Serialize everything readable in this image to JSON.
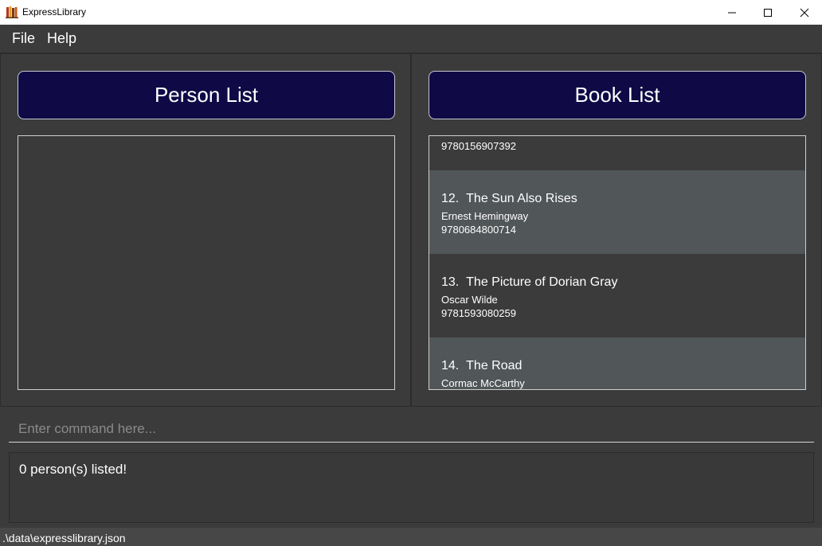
{
  "window": {
    "title": "ExpressLibrary",
    "icon": "books-icon"
  },
  "menu": {
    "file": "File",
    "help": "Help"
  },
  "person_list": {
    "header": "Person List",
    "items": []
  },
  "book_list": {
    "header": "Book List",
    "partial_top_isbn": "9780156907392",
    "books": [
      {
        "index": "12.",
        "title": "The Sun Also Rises",
        "author": "Ernest Hemingway",
        "isbn": "9780684800714"
      },
      {
        "index": "13.",
        "title": "The Picture of Dorian Gray",
        "author": "Oscar Wilde",
        "isbn": "9781593080259"
      },
      {
        "index": "14.",
        "title": "The Road",
        "author": "Cormac McCarthy",
        "isbn": ""
      }
    ]
  },
  "command": {
    "placeholder": "Enter command here...",
    "value": ""
  },
  "result": {
    "message": "0 person(s) listed!"
  },
  "status": {
    "path": ".\\data\\expresslibrary.json"
  },
  "colors": {
    "header_bg": "#0f0a45",
    "background": "#3b3b3b",
    "card_light": "#515658",
    "card_dark": "#3b3b3c"
  }
}
